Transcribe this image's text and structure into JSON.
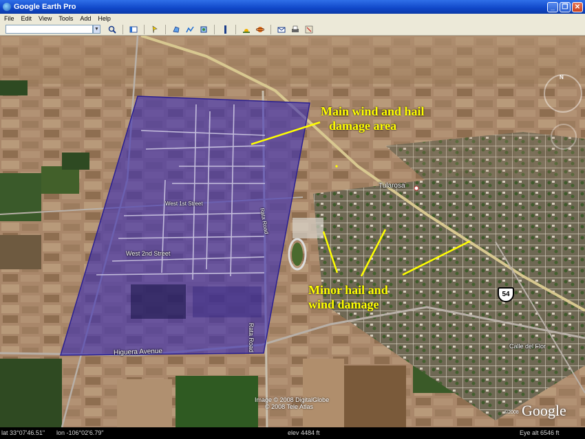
{
  "window": {
    "title": "Google Earth Pro",
    "minimize": "_",
    "restore": "❐",
    "close": "✕"
  },
  "menu": [
    "File",
    "Edit",
    "View",
    "Tools",
    "Add",
    "Help"
  ],
  "toolbar": {
    "search_value": "",
    "icons": [
      "search-icon",
      "sidebar-icon",
      "placemark-icon",
      "polygon-icon",
      "path-icon",
      "overlay-icon",
      "ruler-icon",
      "sun-icon",
      "planets-icon",
      "email-icon",
      "print-icon",
      "maps-icon"
    ]
  },
  "annotations": {
    "main_line1": "Main wind and hail",
    "main_line2": "damage area",
    "minor_line1": "Minor hail and",
    "minor_line2": "wind damage"
  },
  "map_labels": {
    "tularosa": "Tularosa",
    "highway": "54",
    "higuera": "Higuera Avenue",
    "rata_road_bottom": "Rata Road",
    "rata_road": "Rata Road",
    "west_2nd": "West 2nd Street",
    "west_1st": "West 1st Street",
    "calle_del_flor": "Calle del Flor"
  },
  "credits": {
    "image": "Image © 2008 DigitalGlobe",
    "tele": "© 2008 Tele Atlas",
    "logo": "Google",
    "year": "©2008"
  },
  "status": {
    "lat": "lat  33°07'46.51\"",
    "lon": "lon -106°02'6.79\"",
    "elev": "elev  4484 ft",
    "eye": "Eye alt    6546 ft"
  },
  "colors": {
    "polygon": "#3c2fb4",
    "annotation": "#ffff00",
    "titlebar": "#1047c8"
  }
}
